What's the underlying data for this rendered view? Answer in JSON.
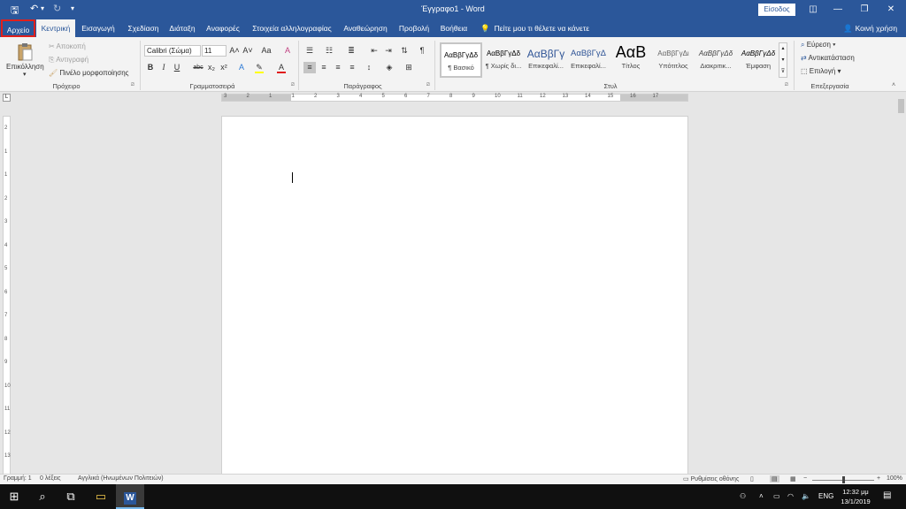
{
  "window": {
    "title": "Έγγραφο1 - Word",
    "signin_label": "Είσοδος",
    "minimize": "—",
    "restore": "❐",
    "close": "✕",
    "ribbon_opts": "◫"
  },
  "qat": {
    "save": "🖫",
    "undo": "↶",
    "undo_drop": "▾",
    "redo": "↻",
    "customize": "▾"
  },
  "tabs": [
    "Αρχείο",
    "Κεντρική",
    "Εισαγωγή",
    "Σχεδίαση",
    "Διάταξη",
    "Αναφορές",
    "Στοιχεία αλληλογραφίας",
    "Αναθεώρηση",
    "Προβολή",
    "Βοήθεια"
  ],
  "tell_me": "Πείτε μου τι θέλετε να κάνετε",
  "share": "Κοινή χρήση",
  "clipboard": {
    "paste": "Επικόλληση",
    "cut": "Αποκοπή",
    "copy": "Αντιγραφή",
    "format_painter": "Πινέλο μορφοποίησης",
    "label": "Πρόχειρο"
  },
  "font": {
    "name": "Calibri (Σώμα)",
    "size": "11",
    "label": "Γραμματοσειρά",
    "accent": "#e01b1b",
    "highlight": "#ffff00",
    "bold": "B",
    "italic": "I",
    "underline": "U",
    "strike": "abc",
    "sub": "x₂",
    "sup": "x²",
    "grow": "A˄",
    "shrink": "A˅",
    "case": "Aa",
    "clear": "A",
    "effects": "A",
    "highlight_icon": "✎",
    "color_icon": "A"
  },
  "paragraph": {
    "label": "Παράγραφος"
  },
  "styles": {
    "label": "Στυλ",
    "items": [
      {
        "sample": "ΑαΒβΓγΔδ",
        "name": "¶ Βασικό"
      },
      {
        "sample": "ΑαΒβΓγΔδ",
        "name": "¶ Χωρίς δι..."
      },
      {
        "sample": "ΑαΒβΓγ",
        "name": "Επικεφαλί..."
      },
      {
        "sample": "ΑαΒβΓγΔ",
        "name": "Επικεφαλί..."
      },
      {
        "sample": "ΑαΒ",
        "name": "Τίτλος"
      },
      {
        "sample": "ΑαΒβΓγΔι",
        "name": "Υπότιτλος"
      },
      {
        "sample": "ΑαΒβΓγΔδ",
        "name": "Διακριτικ..."
      },
      {
        "sample": "ΑαΒβΓγΔδ",
        "name": "Έμφαση"
      }
    ]
  },
  "editing": {
    "find": "Εύρεση",
    "replace": "Αντικατάσταση",
    "select": "Επιλογή",
    "label": "Επεξεργασία"
  },
  "ruler": {
    "h_numbers": [
      "3",
      "2",
      "1",
      "1",
      "2",
      "3",
      "4",
      "5",
      "6",
      "7",
      "8",
      "9",
      "10",
      "11",
      "12",
      "13",
      "14",
      "15",
      "16",
      "17"
    ],
    "v_numbers": [
      "2",
      "1",
      "1",
      "2",
      "3",
      "4",
      "5",
      "6",
      "7",
      "8",
      "9",
      "10",
      "11",
      "12",
      "13"
    ]
  },
  "status": {
    "page": "Γραμμή: 1",
    "words": "0 λέξεις",
    "language": "Αγγλικά (Ηνωμένων Πολιτειών)",
    "display": "Ρυθμίσεις οθόνης",
    "zoom": "100%",
    "minus": "−",
    "plus": "+"
  },
  "taskbar": {
    "time": "12:32 μμ",
    "date": "13/1/2019",
    "lang": "ENG",
    "start": "⊞",
    "search": "⌕",
    "taskview": "⧉",
    "explorer": "▭",
    "word": "W",
    "notifications": "▤"
  }
}
